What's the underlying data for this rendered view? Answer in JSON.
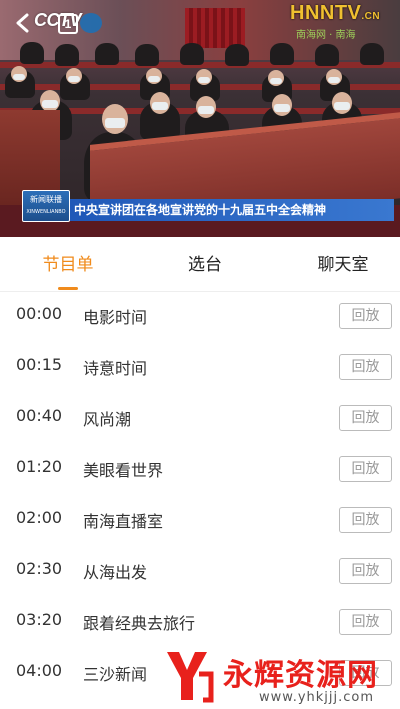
{
  "player": {
    "channel_logo": "CCTV",
    "channel_number": "1",
    "station_logo": "HNNTV",
    "station_logo_suffix": ".CN",
    "station_subtitle": "南海网 · 南海",
    "program_logo": "新闻联播",
    "program_logo_sub": "XINWENLIANBO",
    "caption": "中央宣讲团在各地宣讲党的十九届五中全会精神",
    "back_icon": "chevron-left-icon"
  },
  "tabs": [
    {
      "label": "节目单",
      "active": true
    },
    {
      "label": "选台",
      "active": false
    },
    {
      "label": "聊天室",
      "active": false
    }
  ],
  "schedule": [
    {
      "time": "00:00",
      "title": "电影时间",
      "action": "回放"
    },
    {
      "time": "00:15",
      "title": "诗意时间",
      "action": "回放"
    },
    {
      "time": "00:40",
      "title": "风尚潮",
      "action": "回放"
    },
    {
      "time": "01:20",
      "title": "美眼看世界",
      "action": "回放"
    },
    {
      "time": "02:00",
      "title": "南海直播室",
      "action": "回放"
    },
    {
      "time": "02:30",
      "title": "从海出发",
      "action": "回放"
    },
    {
      "time": "03:20",
      "title": "跟着经典去旅行",
      "action": "回放"
    },
    {
      "time": "04:00",
      "title": "三沙新闻",
      "action": "回放"
    }
  ],
  "watermark": {
    "text": "永辉资源网",
    "url": "www.yhkjjj.com"
  },
  "colors": {
    "accent": "#f08b1c",
    "caption_bg": "#1f58b8",
    "watermark": "#e8211c"
  }
}
